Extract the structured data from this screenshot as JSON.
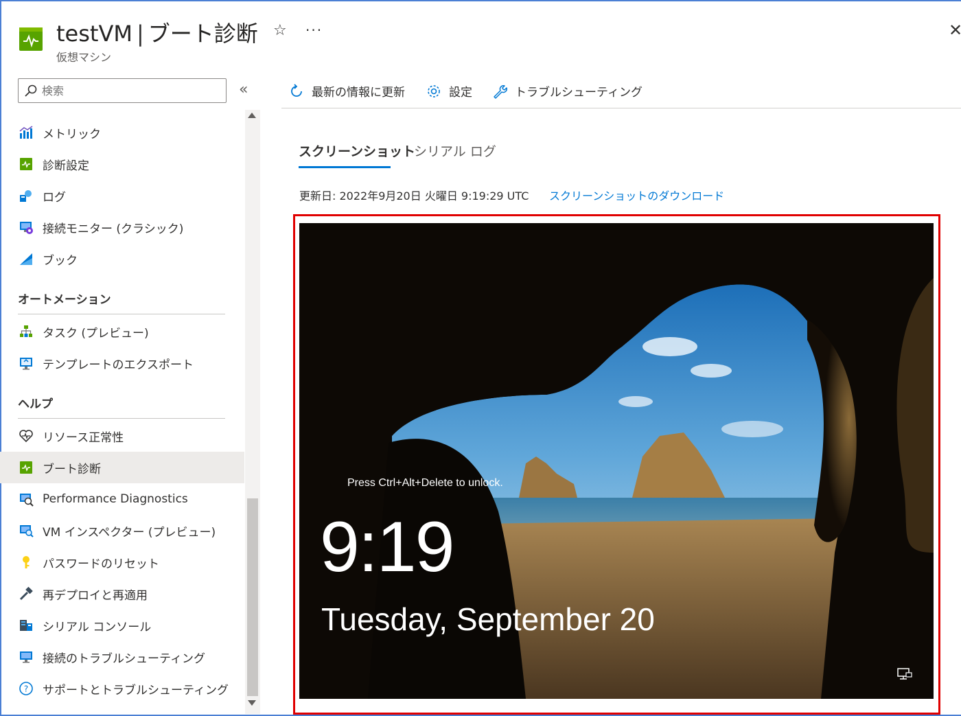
{
  "header": {
    "title_name": "testVM",
    "title_separator": "|",
    "title_page": "ブート診断",
    "subtitle": "仮想マシン",
    "star_icon": "☆",
    "more_icon": "···",
    "close_icon": "✕"
  },
  "sidebar": {
    "search_placeholder": "検索",
    "collapse_icon": "«",
    "items_top": [
      {
        "label": "メトリック",
        "icon": "metrics-icon"
      },
      {
        "label": "診断設定",
        "icon": "diagnostic-settings-icon"
      },
      {
        "label": "ログ",
        "icon": "logs-icon"
      },
      {
        "label": "接続モニター (クラシック)",
        "icon": "connection-monitor-icon"
      },
      {
        "label": "ブック",
        "icon": "workbooks-icon"
      }
    ],
    "section_automation": "オートメーション",
    "items_automation": [
      {
        "label": "タスク (プレビュー)",
        "icon": "tasks-icon"
      },
      {
        "label": "テンプレートのエクスポート",
        "icon": "export-template-icon"
      }
    ],
    "section_help": "ヘルプ",
    "items_help": [
      {
        "label": "リソース正常性",
        "icon": "resource-health-icon"
      },
      {
        "label": "ブート診断",
        "icon": "boot-diagnostics-icon",
        "selected": true
      },
      {
        "label": "Performance Diagnostics",
        "icon": "performance-diagnostics-icon"
      },
      {
        "label": "VM インスペクター (プレビュー)",
        "icon": "vm-inspector-icon"
      },
      {
        "label": "パスワードのリセット",
        "icon": "reset-password-icon"
      },
      {
        "label": "再デプロイと再適用",
        "icon": "redeploy-icon"
      },
      {
        "label": "シリアル コンソール",
        "icon": "serial-console-icon"
      },
      {
        "label": "接続のトラブルシューティング",
        "icon": "connection-troubleshoot-icon"
      },
      {
        "label": "サポートとトラブルシューティング",
        "icon": "support-icon"
      }
    ]
  },
  "toolbar": {
    "refresh_label": "最新の情報に更新",
    "settings_label": "設定",
    "troubleshoot_label": "トラブルシューティング"
  },
  "tabs": {
    "screenshot": "スクリーンショット",
    "serial_log": "シリアル ログ"
  },
  "content": {
    "updated_text": "更新日: 2022年9月20日 火曜日 9:19:29 UTC",
    "download_link": "スクリーンショットのダウンロード"
  },
  "lockscreen": {
    "unlock_hint": "Press Ctrl+Alt+Delete to unlock.",
    "time": "9:19",
    "date": "Tuesday, September 20"
  },
  "colors": {
    "accent": "#0078d4",
    "highlight_border": "#e00000",
    "vm_green": "#57a300"
  }
}
